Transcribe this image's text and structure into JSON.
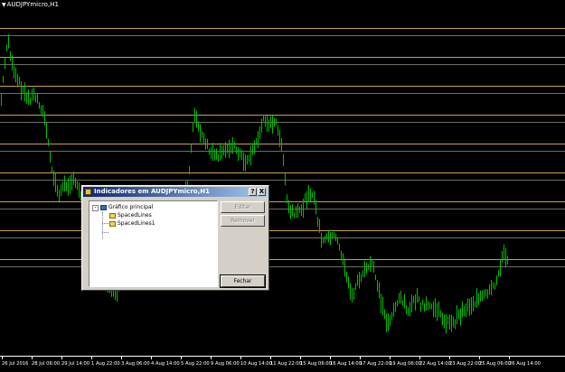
{
  "window": {
    "title": "AUDJPYmicro,H1"
  },
  "chart_data": {
    "type": "line",
    "series_color": "#00c000",
    "level_line_color": "#c8a050",
    "level_line_color_light": "#c8c8b4",
    "x_labels": [
      "26 Jul 2016",
      "28 Jul 06:00",
      "29 Jul 14:00",
      "1 Aug 22:00",
      "3 Aug 06:00",
      "4 Aug 14:00",
      "5 Aug 22:00",
      "9 Aug 06:00",
      "10 Aug 14:00",
      "11 Aug 22:00",
      "15 Aug 06:00",
      "16 Aug 14:00",
      "17 Aug 22:00",
      "19 Aug 06:00",
      "22 Aug 14:00",
      "23 Aug 22:00",
      "25 Aug 06:00",
      "26 Aug 14:00"
    ]
  },
  "dialog": {
    "title": "Indicadores em AUDJPYmicro,H1",
    "help_label": "?",
    "close_label": "X",
    "tree": {
      "root": "Gráfico principal",
      "children": [
        "SpacedLines",
        "SpacedLines1"
      ]
    },
    "buttons": {
      "edit": "Editar",
      "remove": "Remover",
      "close": "Fechar"
    }
  }
}
